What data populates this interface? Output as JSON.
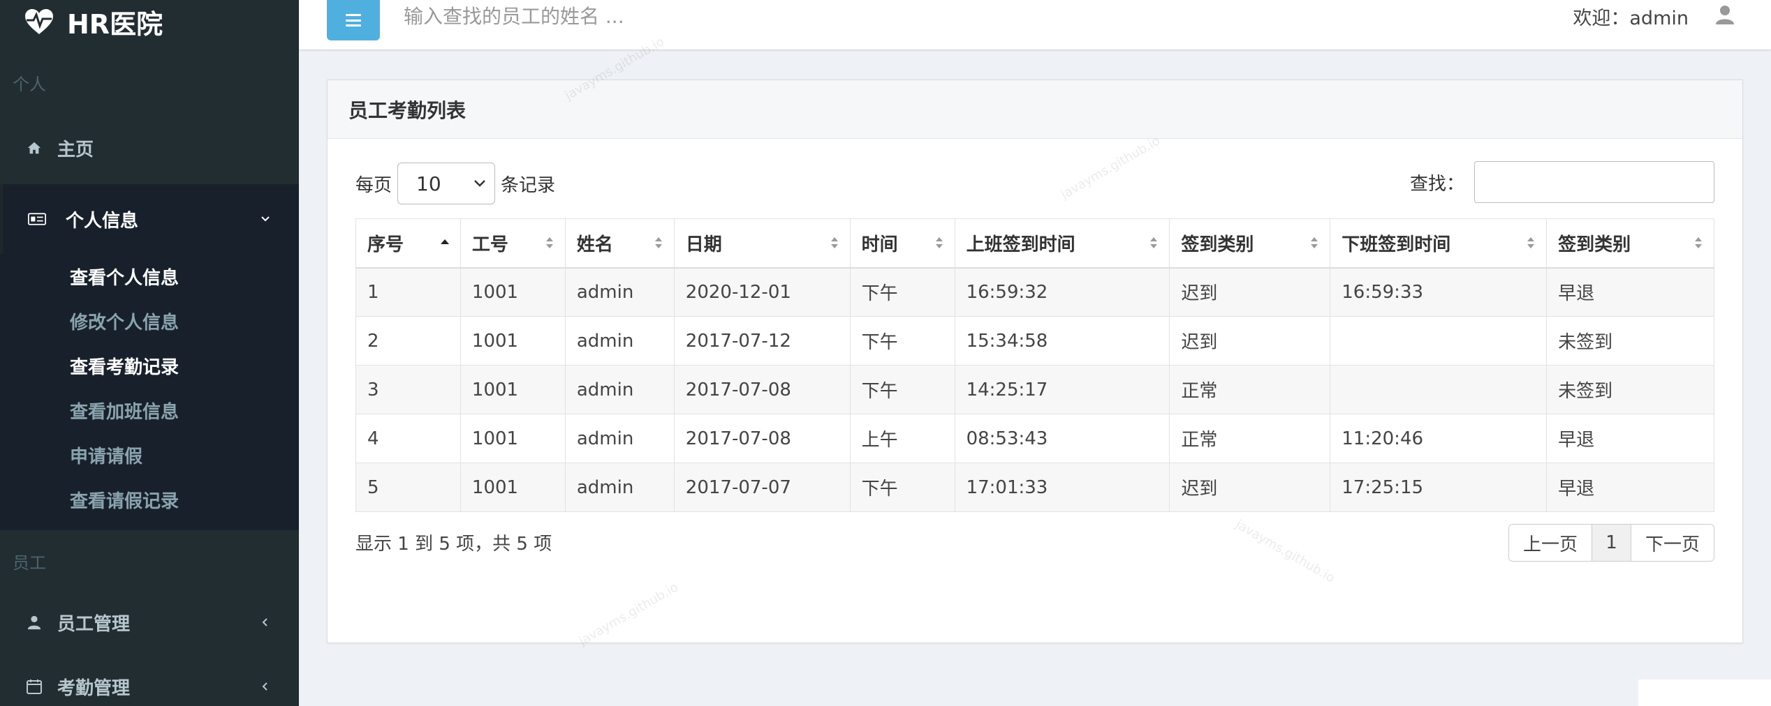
{
  "brand": {
    "name": "HR医院",
    "logo_icon": "heartbeat-icon"
  },
  "sidebar": {
    "section_personal": "个人",
    "home": "主页",
    "personal_info": {
      "label": "个人信息",
      "items": [
        {
          "label": "查看个人信息",
          "active": true
        },
        {
          "label": "修改个人信息",
          "active": false
        },
        {
          "label": "查看考勤记录",
          "active": true
        },
        {
          "label": "查看加班信息",
          "active": false
        },
        {
          "label": "申请请假",
          "active": false
        },
        {
          "label": "查看请假记录",
          "active": false
        }
      ]
    },
    "section_staff": "员工",
    "staff_manage": "员工管理",
    "attendance_manage": "考勤管理"
  },
  "topbar": {
    "search_placeholder": "输入查找的员工的姓名 ...",
    "welcome": "欢迎：admin"
  },
  "box": {
    "title": "员工考勤列表",
    "per_page_prefix": "每页",
    "per_page_value": "10",
    "per_page_suffix": "条记录",
    "search_label": "查找："
  },
  "table": {
    "columns": [
      "序号",
      "工号",
      "姓名",
      "日期",
      "时间",
      "上班签到时间",
      "签到类别",
      "下班签到时间",
      "签到类别"
    ],
    "rows": [
      [
        "1",
        "1001",
        "admin",
        "2020-12-01",
        "下午",
        "16:59:32",
        "迟到",
        "16:59:33",
        "早退"
      ],
      [
        "2",
        "1001",
        "admin",
        "2017-07-12",
        "下午",
        "15:34:58",
        "迟到",
        "",
        "未签到"
      ],
      [
        "3",
        "1001",
        "admin",
        "2017-07-08",
        "下午",
        "14:25:17",
        "正常",
        "",
        "未签到"
      ],
      [
        "4",
        "1001",
        "admin",
        "2017-07-08",
        "上午",
        "08:53:43",
        "正常",
        "11:20:46",
        "早退"
      ],
      [
        "5",
        "1001",
        "admin",
        "2017-07-07",
        "下午",
        "17:01:33",
        "迟到",
        "17:25:15",
        "早退"
      ]
    ]
  },
  "footer": {
    "info": "显示 1 到 5 项，共 5 项",
    "prev": "上一页",
    "current": "1",
    "next": "下一页"
  },
  "watermark": "javayms.github.io",
  "colors": {
    "sidebar": "#222d32",
    "accent": "#4fb0e0"
  }
}
